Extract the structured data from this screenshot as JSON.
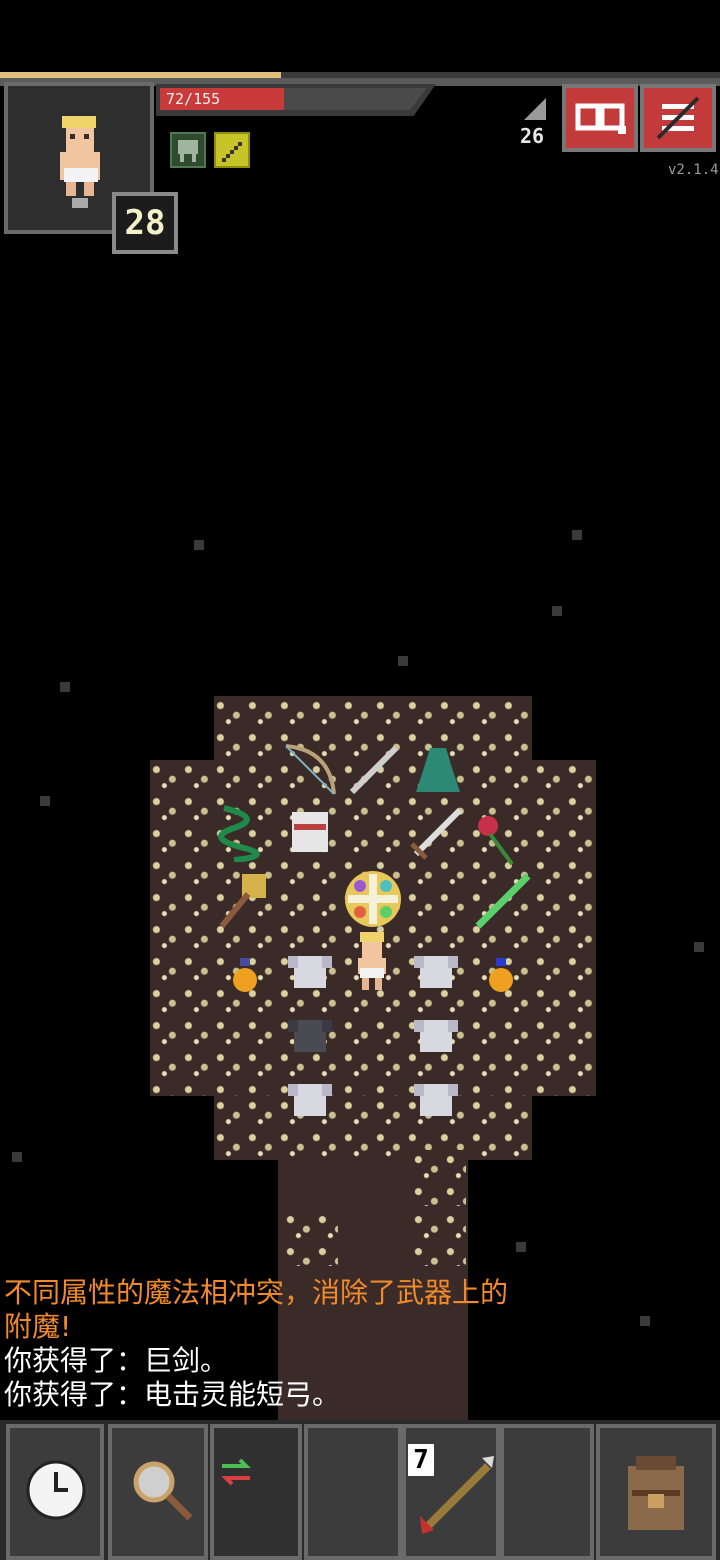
{
  "hud": {
    "hp_text": "72/155",
    "hp_fraction": 0.4645,
    "xp_fraction": 0.39,
    "level": "28",
    "depth": "26",
    "version": "v2.1.4"
  },
  "buffs": [
    {
      "icon": "helmet-buff-icon"
    },
    {
      "icon": "sword-buff-icon"
    }
  ],
  "log": {
    "warning_line1": "不同属性的魔法相冲突，消除了武器上的",
    "warning_line2": "附魔!",
    "info1": "你获得了：巨剑。",
    "info2": "你获得了：电击灵能短弓。"
  },
  "toolbar": {
    "quickslot_count": "7"
  },
  "colors": {
    "hp": "#c93a3a",
    "xp": "#e0c07a",
    "warning_text": "#f08a2a",
    "info_text": "#ffffff",
    "button_red": "#c23a3a"
  }
}
